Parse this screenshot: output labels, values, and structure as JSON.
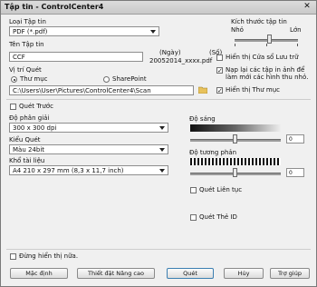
{
  "window": {
    "title": "Tập tin - ControlCenter4",
    "close_glyph": "✕"
  },
  "file_type": {
    "label": "Loại Tập tin",
    "value": "PDF (*.pdf)"
  },
  "file_name": {
    "label": "Tên Tập tin",
    "value": "CCF",
    "date_label": "(Ngày)",
    "number_label": "(Số)",
    "example": "20052014_xxxx.pdf"
  },
  "file_size": {
    "label": "Kích thước tập tin",
    "min_label": "Nhỏ",
    "max_label": "Lớn",
    "level": 0.55
  },
  "options": {
    "show_save_window": "Hiển thị Cửa sổ Lưu trữ",
    "load_all_images": "Nạp lại các tập in ảnh để làm mới các hình thu nhỏ.",
    "show_folder": "Hiển thị Thư mục",
    "show_save_window_checked": false,
    "load_all_images_checked": true,
    "show_folder_checked": true
  },
  "destination": {
    "label": "Vị trí Quét",
    "folder_option": "Thư mục",
    "sharepoint_option": "SharePoint",
    "selected": "Thư mục",
    "path": "C:\\Users\\User\\Pictures\\ControlCenter4\\Scan"
  },
  "prescan": {
    "label": "Quét Trước",
    "checked": false
  },
  "resolution": {
    "label": "Độ phân giải",
    "value": "300 x 300 dpi"
  },
  "scan_type": {
    "label": "Kiểu Quét",
    "value": "Màu 24bit"
  },
  "document_size": {
    "label": "Khổ tài liệu",
    "value": "A4 210 x 297 mm (8,3 x 11,7 inch)"
  },
  "brightness": {
    "label": "Độ sáng",
    "value": "0",
    "level": 0.5
  },
  "contrast": {
    "label": "Độ tương phản",
    "value": "0",
    "level": 0.5
  },
  "continuous_scan": {
    "label": "Quét Liên tục",
    "checked": false
  },
  "id_card_scan": {
    "label": "Quét Thẻ ID",
    "checked": false
  },
  "dont_show_again": {
    "label": "Đừng hiển thị nữa.",
    "checked": false
  },
  "buttons": {
    "default": "Mặc định",
    "advanced": "Thiết đặt Nâng cao",
    "scan": "Quét",
    "cancel": "Hủy",
    "help": "Trợ giúp"
  }
}
